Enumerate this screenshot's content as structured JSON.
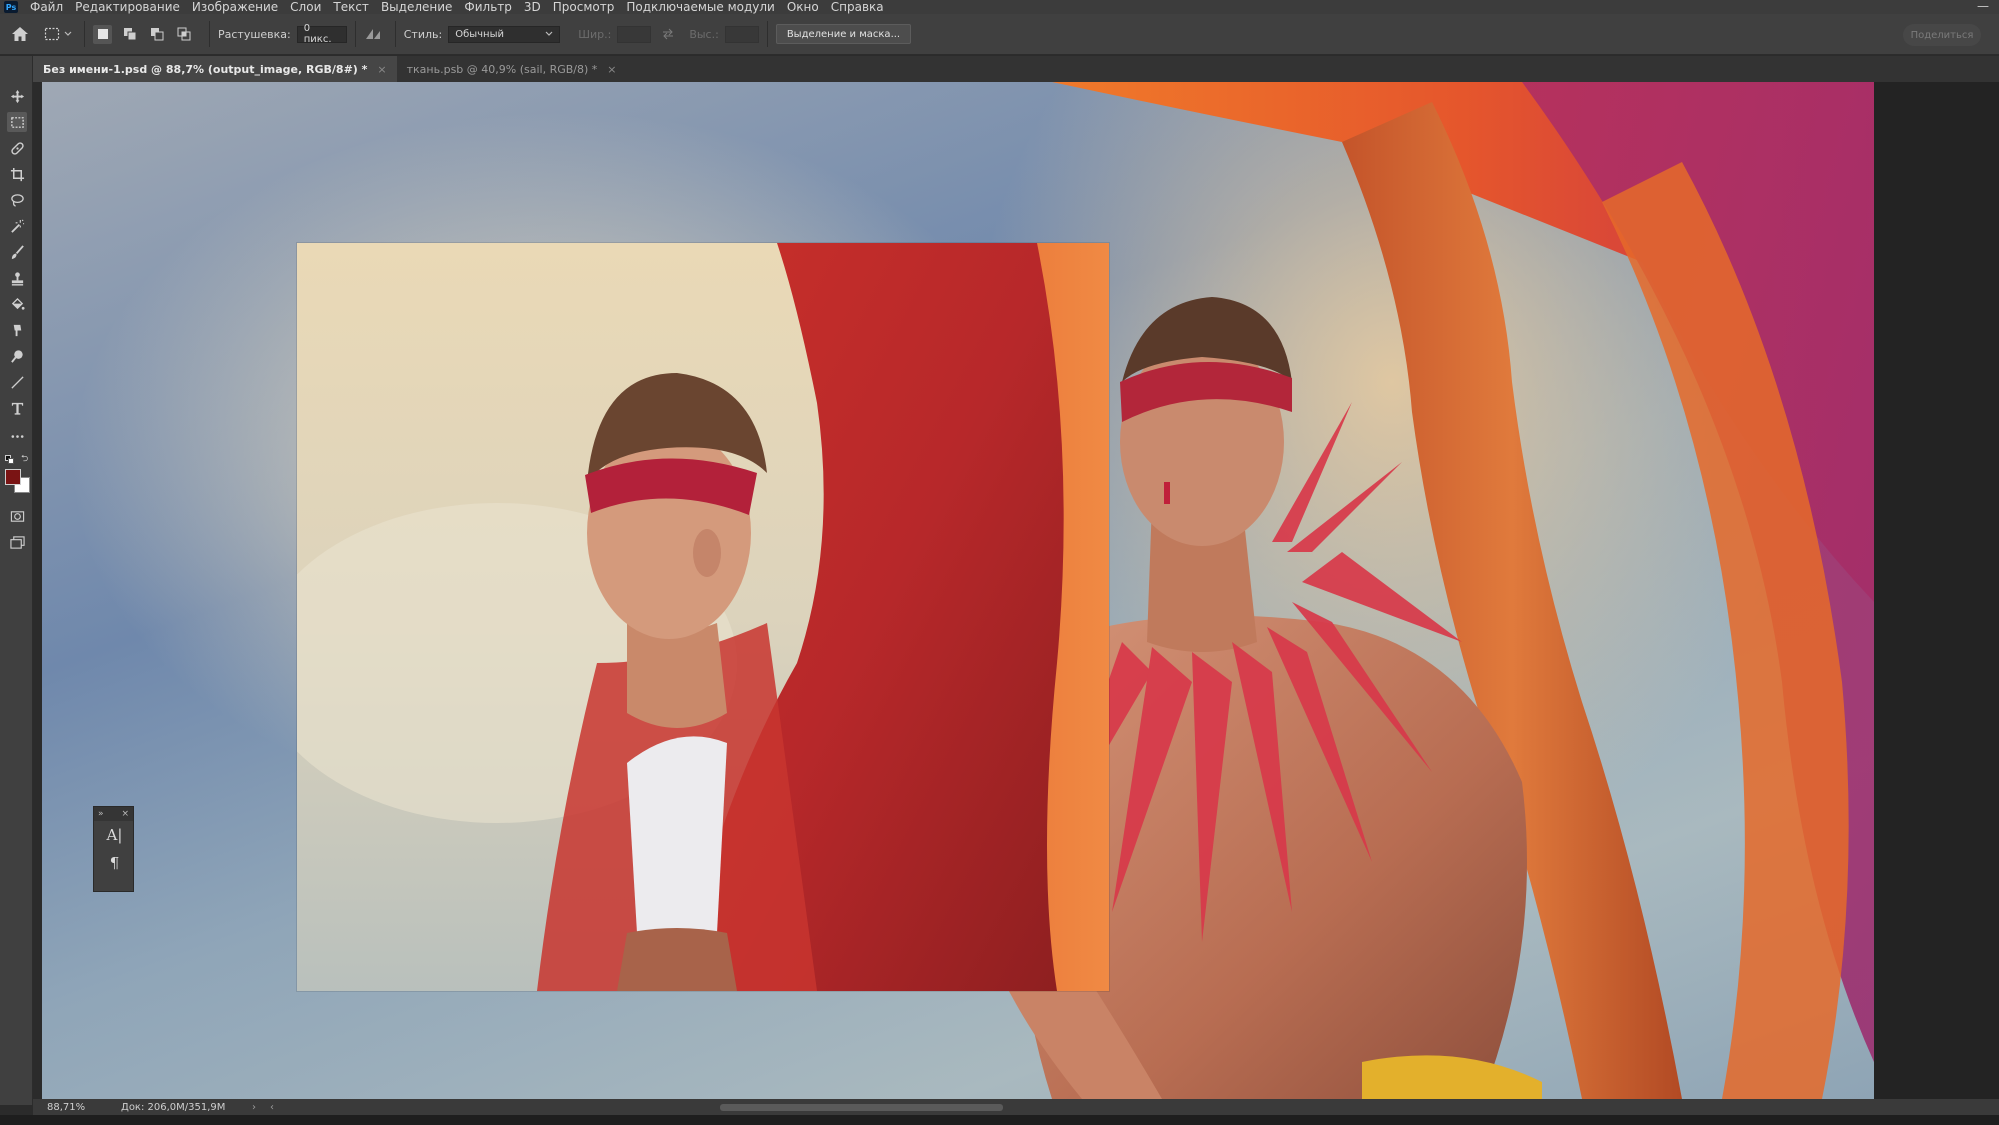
{
  "app": {
    "logo_text": "Ps"
  },
  "menu": {
    "items": [
      "Файл",
      "Редактирование",
      "Изображение",
      "Слои",
      "Текст",
      "Выделение",
      "Фильтр",
      "3D",
      "Просмотр",
      "Подключаемые модули",
      "Окно",
      "Справка"
    ]
  },
  "options_bar": {
    "feather_label": "Растушевка:",
    "feather_value": "0 пикс.",
    "style_label": "Стиль:",
    "style_value": "Обычный",
    "width_label": "Шир.:",
    "height_label": "Выс.:",
    "select_mask_button": "Выделение и маска...",
    "share_button": "Поделиться"
  },
  "tabs": [
    {
      "label": "Без имени-1.psd @ 88,7% (output_image, RGB/8#) *",
      "active": true
    },
    {
      "label": "ткань.psb @ 40,9% (sail, RGB/8) *",
      "active": false
    }
  ],
  "colors": {
    "foreground": "#7a1414",
    "background": "#ffffff",
    "accent": "#31a8ff"
  },
  "float_panel": {
    "character_icon": "A|",
    "paragraph_icon": "¶"
  },
  "status": {
    "zoom": "88,71%",
    "doc_info": "Док: 206,0М/351,9М",
    "arrow": "›",
    "scroll_left": "‹"
  }
}
